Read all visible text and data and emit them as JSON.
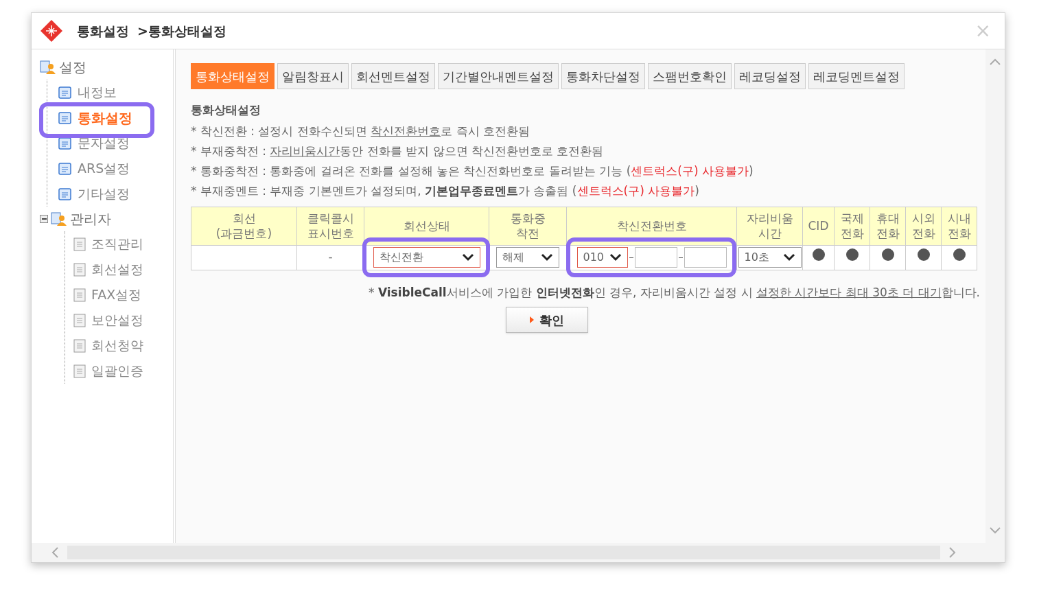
{
  "window": {
    "title": "통화설정",
    "subtitle": ">통화상태설정",
    "close": "×"
  },
  "sidebar": {
    "items": [
      {
        "label": "설정",
        "kind": "group",
        "selected": false,
        "children": [
          {
            "label": "내정보",
            "kind": "page",
            "selected": false
          },
          {
            "label": "통화설정",
            "kind": "page",
            "selected": true
          },
          {
            "label": "문자설정",
            "kind": "page",
            "selected": false
          },
          {
            "label": "ARS설정",
            "kind": "page",
            "selected": false
          },
          {
            "label": "기타설정",
            "kind": "page",
            "selected": false
          }
        ]
      },
      {
        "label": "관리자",
        "kind": "group",
        "selected": false,
        "expanded": true,
        "children": [
          {
            "label": "조직관리",
            "kind": "doc",
            "selected": false
          },
          {
            "label": "회선설정",
            "kind": "doc",
            "selected": false
          },
          {
            "label": "FAX설정",
            "kind": "doc",
            "selected": false
          },
          {
            "label": "보안설정",
            "kind": "doc",
            "selected": false
          },
          {
            "label": "회선청약",
            "kind": "doc",
            "selected": false
          },
          {
            "label": "일괄인증",
            "kind": "doc",
            "selected": false
          }
        ]
      }
    ]
  },
  "tabs": [
    {
      "label": "통화상태설정",
      "selected": true
    },
    {
      "label": "알림창표시",
      "selected": false
    },
    {
      "label": "회선멘트설정",
      "selected": false
    },
    {
      "label": "기간별안내멘트설정",
      "selected": false
    },
    {
      "label": "통화차단설정",
      "selected": false
    },
    {
      "label": "스팸번호확인",
      "selected": false
    },
    {
      "label": "레코딩설정",
      "selected": false
    },
    {
      "label": "레코딩멘트설정",
      "selected": false
    }
  ],
  "section_title": "통화상태설정",
  "notes": [
    [
      {
        "text": "* 착신전환 : 설정시 전화수신되면 ",
        "kind": "plain"
      },
      {
        "text": "착신전환번호",
        "kind": "underline"
      },
      {
        "text": "로 즉시 호전환됨",
        "kind": "plain"
      }
    ],
    [
      {
        "text": "* 부재중착전 : ",
        "kind": "plain"
      },
      {
        "text": "자리비움시간",
        "kind": "underline"
      },
      {
        "text": "동안 전화를 받지 않으면 착신전환번호로 호전환됨",
        "kind": "plain"
      }
    ],
    [
      {
        "text": "* 통화중착전 : 통화중에 걸려온 전화를 설정해 놓은 착신전화번호로 돌려받는 기능 (",
        "kind": "plain"
      },
      {
        "text": "센트럭스(구) 사용불가",
        "kind": "red"
      },
      {
        "text": ")",
        "kind": "plain"
      }
    ],
    [
      {
        "text": "* 부재중멘트 : 부재중 기본멘트가 설정되며, ",
        "kind": "plain"
      },
      {
        "text": "기본업무종료멘트",
        "kind": "bold"
      },
      {
        "text": "가 송출됨 (",
        "kind": "plain"
      },
      {
        "text": "센트럭스(구) 사용불가",
        "kind": "red"
      },
      {
        "text": ")",
        "kind": "plain"
      }
    ]
  ],
  "table": {
    "columns": [
      "회선\n(과금번호)",
      "클릭콜시\n표시번호",
      "회선상태",
      "통화중\n착전",
      "착신전환번호",
      "자리비움\n시간",
      "CID",
      "국제\n전화",
      "휴대\n전화",
      "시외\n전화",
      "시내\n전화"
    ],
    "row": [
      {
        "kind": "empty"
      },
      {
        "kind": "text",
        "text": "-"
      },
      {
        "kind": "select",
        "value": "착신전환",
        "highlighted": true
      },
      {
        "kind": "select",
        "value": "해제",
        "highlighted": false
      },
      {
        "kind": "phone",
        "value": "010",
        "highlighted": true
      },
      {
        "kind": "select",
        "value": "10초",
        "highlighted": false
      },
      {
        "kind": "dot"
      },
      {
        "kind": "dot"
      },
      {
        "kind": "dot"
      },
      {
        "kind": "dot"
      },
      {
        "kind": "dot"
      }
    ]
  },
  "footnote": [
    {
      "text": "* ",
      "kind": "plain"
    },
    {
      "text": "VisibleCall",
      "kind": "bold"
    },
    {
      "text": "서비스에 가입한 ",
      "kind": "plain"
    },
    {
      "text": "인터넷전화",
      "kind": "bold"
    },
    {
      "text": "인 경우, 자리비움시간 설정 시 ",
      "kind": "plain"
    },
    {
      "text": "설정한 시간보다 최대 30초 더 대기",
      "kind": "underline"
    },
    {
      "text": "합니다.",
      "kind": "plain"
    }
  ],
  "confirm_button": "확인"
}
